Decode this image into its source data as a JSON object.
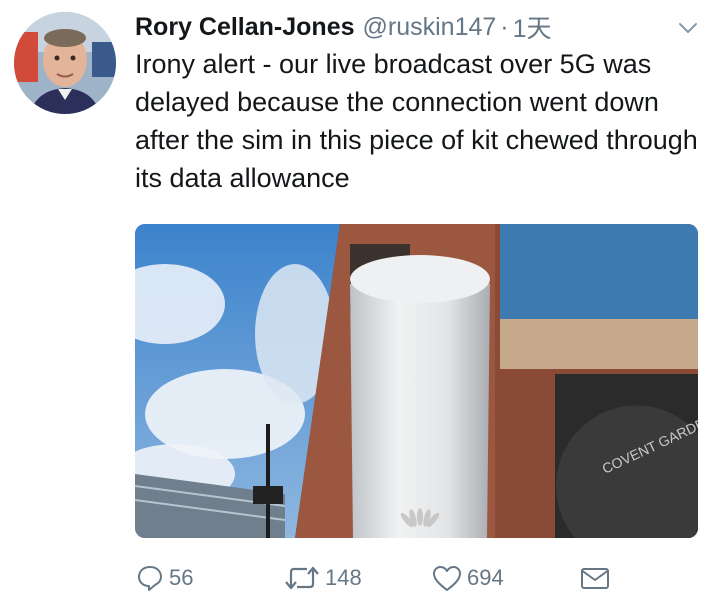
{
  "tweet": {
    "author": {
      "display_name": "Rory Cellan-Jones",
      "handle": "@ruskin147",
      "separator": "·",
      "time": "1天",
      "avatar": "avatar-photo"
    },
    "text": "Irony alert - our live broadcast over 5G was delayed because the connection went down after the sim in this piece of kit chewed through its data allowance",
    "media": {
      "kind": "photo",
      "description_icon": "photo-of-5g-router",
      "sign_text": "COVENT GARDEN MARKET"
    },
    "actions": {
      "reply_count": "56",
      "retweet_count": "148",
      "like_count": "694"
    },
    "icons": {
      "reply": "reply-icon",
      "retweet": "retweet-icon",
      "like": "like-icon",
      "dm": "direct-message-icon",
      "caret": "chevron-down-icon"
    },
    "colors": {
      "text": "#14171a",
      "secondary": "#657786"
    }
  }
}
